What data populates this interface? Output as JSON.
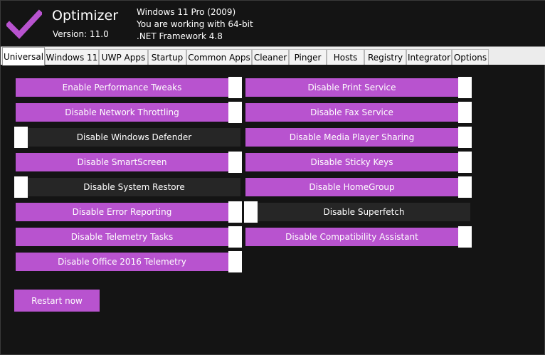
{
  "app": {
    "title": "Optimizer",
    "version": "Version: 11.0",
    "os_line": "Windows 11 Pro (2009)",
    "arch_line": "You are working with 64-bit",
    "framework_line": ".NET Framework 4.8",
    "accent_color": "#b853cf"
  },
  "tabs": [
    {
      "label": "Universal",
      "active": true
    },
    {
      "label": "Windows 11"
    },
    {
      "label": "UWP Apps"
    },
    {
      "label": "Startup"
    },
    {
      "label": "Common Apps"
    },
    {
      "label": "Cleaner"
    },
    {
      "label": "Pinger"
    },
    {
      "label": "Hosts"
    },
    {
      "label": "Registry"
    },
    {
      "label": "Integrator"
    },
    {
      "label": "Options"
    }
  ],
  "toggles_left": [
    {
      "label": "Enable Performance Tweaks",
      "on": true
    },
    {
      "label": "Disable Network Throttling",
      "on": true
    },
    {
      "label": "Disable Windows Defender",
      "on": false
    },
    {
      "label": "Disable SmartScreen",
      "on": true
    },
    {
      "label": "Disable System Restore",
      "on": false
    },
    {
      "label": "Disable Error Reporting",
      "on": true
    },
    {
      "label": "Disable Telemetry Tasks",
      "on": true
    },
    {
      "label": "Disable Office 2016 Telemetry",
      "on": true
    }
  ],
  "toggles_right": [
    {
      "label": "Disable Print Service",
      "on": true
    },
    {
      "label": "Disable Fax Service",
      "on": true
    },
    {
      "label": "Disable Media Player Sharing",
      "on": true
    },
    {
      "label": "Disable Sticky Keys",
      "on": true
    },
    {
      "label": "Disable HomeGroup",
      "on": true
    },
    {
      "label": "Disable Superfetch",
      "on": false
    },
    {
      "label": "Disable Compatibility Assistant",
      "on": true
    }
  ],
  "restart_label": "Restart now"
}
